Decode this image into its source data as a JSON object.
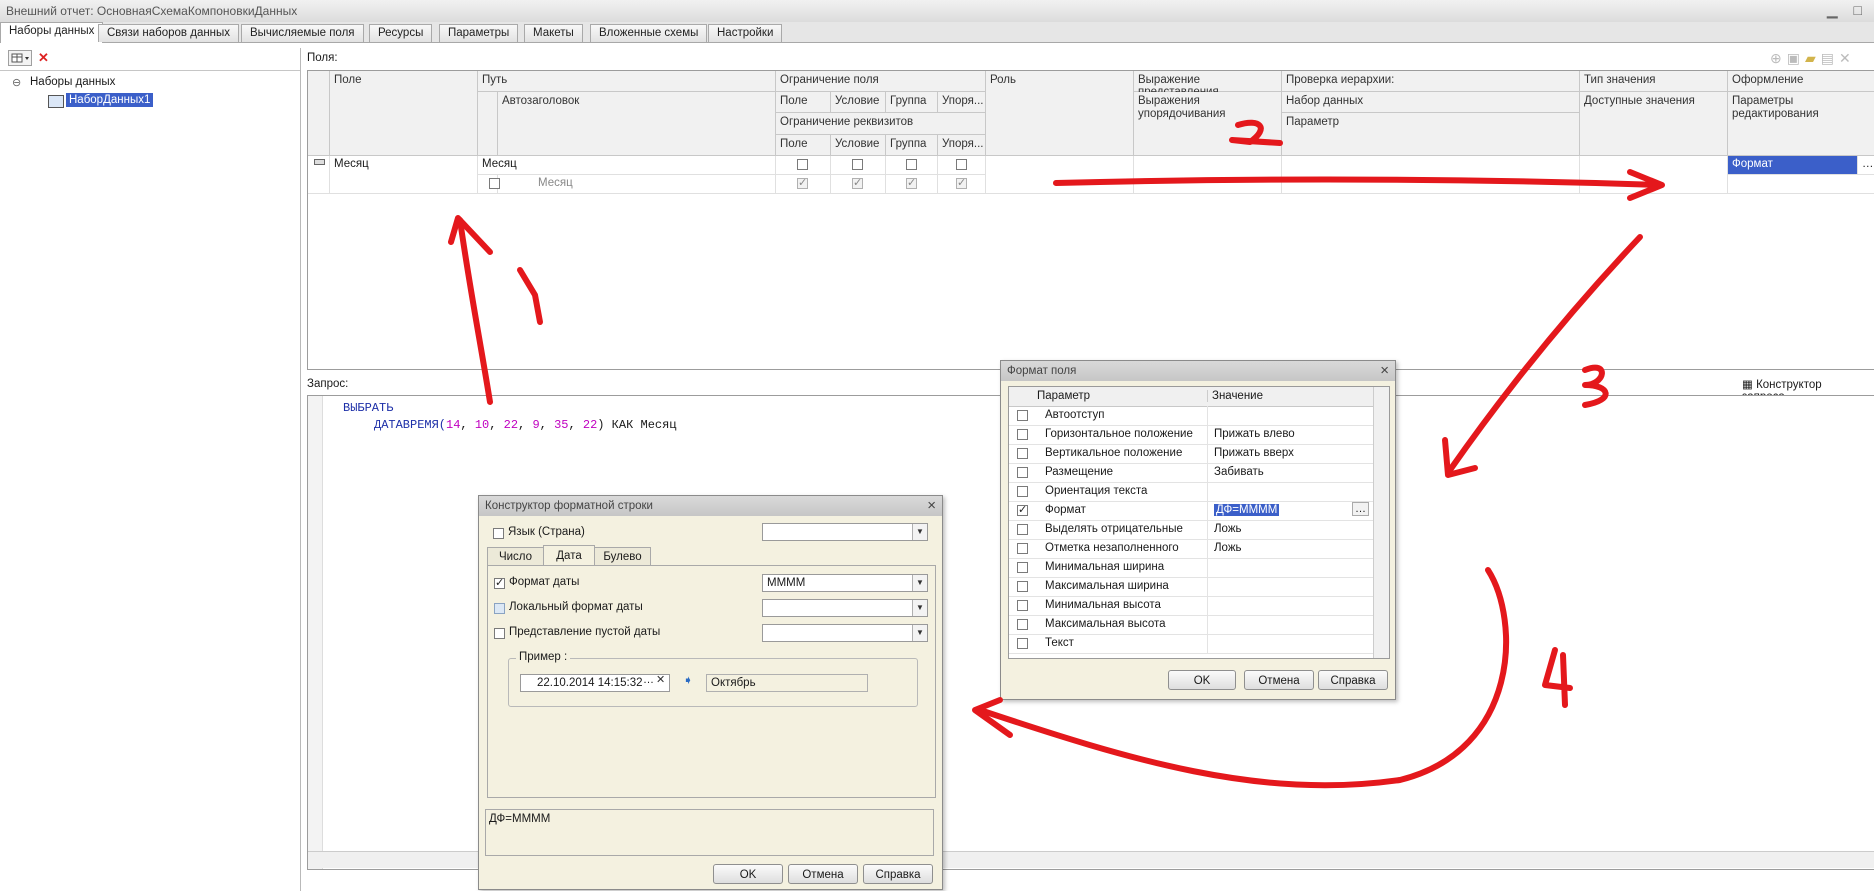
{
  "window": {
    "title": "Внешний отчет: ОсновнаяСхемаКомпоновкиДанных"
  },
  "tabs": [
    "Наборы данных",
    "Связи наборов данных",
    "Вычисляемые поля",
    "Ресурсы",
    "Параметры",
    "Макеты",
    "Вложенные схемы",
    "Настройки"
  ],
  "tree": {
    "root": "Наборы данных",
    "child": "НаборДанных1"
  },
  "fields_label": "Поля:",
  "grid_headers": {
    "pole": "Поле",
    "put": "Путь",
    "avtozagolovok": "Автозаголовок",
    "ogr_polya": "Ограничение поля",
    "sub_pole": "Поле",
    "sub_uslovie": "Условие",
    "sub_gruppa": "Группа",
    "sub_upor": "Упоря...",
    "ogr_rekv": "Ограничение реквизитов",
    "sub2_pole": "Поле",
    "sub2_uslovie": "Условие",
    "sub2_gruppa": "Группа",
    "sub2_upor": "Упоря...",
    "rol": "Роль",
    "vyr_pred": "Выражение представления",
    "vyr_upor": "Выражения упорядочивания",
    "prov_ier": "Проверка иерархии:",
    "nabor": "Набор данных",
    "parametr": "Параметр",
    "tip": "Тип значения",
    "dost": "Доступные значения",
    "oform": "Оформление",
    "param_red": "Параметры редактирования"
  },
  "grid_row": {
    "field": "Месяц",
    "path": "Месяц",
    "autotitle": "Месяц",
    "format": "Формат"
  },
  "query_label": "Запрос:",
  "query_constructor": "Конструктор запроса...",
  "query": {
    "kw": "ВЫБРАТЬ",
    "fn": "ДАТАВРЕМЯ(",
    "args": [
      "14",
      "10",
      "22",
      "9",
      "35",
      "22"
    ],
    "tail": ") КАК Месяц"
  },
  "format_dialog": {
    "title": "Формат поля",
    "col_param": "Параметр",
    "col_value": "Значение",
    "rows": [
      {
        "name": "Автоотступ",
        "value": "",
        "checked": false
      },
      {
        "name": "Горизонтальное положение",
        "value": "Прижать влево",
        "checked": false
      },
      {
        "name": "Вертикальное положение",
        "value": "Прижать вверх",
        "checked": false
      },
      {
        "name": "Размещение",
        "value": "Забивать",
        "checked": false
      },
      {
        "name": "Ориентация текста",
        "value": "",
        "checked": false
      },
      {
        "name": "Формат",
        "value": "ДФ=ММММ",
        "checked": true
      },
      {
        "name": "Выделять отрицательные",
        "value": "Ложь",
        "checked": false
      },
      {
        "name": "Отметка незаполненного",
        "value": "Ложь",
        "checked": false
      },
      {
        "name": "Минимальная ширина",
        "value": "",
        "checked": false
      },
      {
        "name": "Максимальная ширина",
        "value": "",
        "checked": false
      },
      {
        "name": "Минимальная высота",
        "value": "",
        "checked": false
      },
      {
        "name": "Максимальная высота",
        "value": "",
        "checked": false
      },
      {
        "name": "Текст",
        "value": "",
        "checked": false
      }
    ],
    "ok": "OK",
    "cancel": "Отмена",
    "help": "Справка"
  },
  "constructor_dialog": {
    "title": "Конструктор форматной строки",
    "lang": "Язык (Страна)",
    "tabs": [
      "Число",
      "Дата",
      "Булево"
    ],
    "date_format_label": "Формат даты",
    "date_format_value": "ММММ",
    "local_format_label": "Локальный формат даты",
    "empty_date_label": "Представление пустой даты",
    "example_label": "Пример :",
    "example_date": "22.10.2014 14:15:32",
    "example_result": "Октябрь",
    "result_string": "ДФ=ММММ",
    "ok": "OK",
    "cancel": "Отмена",
    "help": "Справка"
  },
  "annotations": [
    "1",
    "2",
    "3",
    "4"
  ],
  "colors": {
    "annotation": "#e4181c",
    "selection": "#3b5fc9",
    "keyword": "#1d2fa8",
    "number": "#c000c0"
  }
}
